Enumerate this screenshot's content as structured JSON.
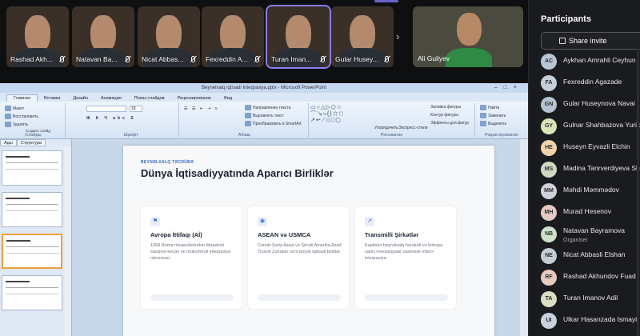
{
  "video_tiles": [
    {
      "name": "Rashad Akh..."
    },
    {
      "name": "Natavan Ba..."
    },
    {
      "name": "Nicat Abbas..."
    },
    {
      "name": "Fexreddin A..."
    },
    {
      "name": "Turan Iman..."
    },
    {
      "name": "Gular Husey..."
    }
  ],
  "featured_tile": {
    "name": "Ali Guliyev"
  },
  "next_icon": "›",
  "ppt": {
    "window_title": "Beynelxalq iqtisadi Inteqrasiya.pptx - Microsoft PowerPoint",
    "tabs": [
      "Главная",
      "Вставка",
      "Дизайн",
      "Анимация",
      "Показ слайдов",
      "Рецензирование",
      "Вид"
    ],
    "ribbon": {
      "paste_label": "Создать слайд",
      "layout_label": "Макет",
      "reset_label": "Восстановить",
      "delete_label": "Удалить",
      "group_slides": "Слайды",
      "group_font": "Шрифт",
      "group_paragraph": "Абзац",
      "group_drawing": "Рисование",
      "group_editing": "Редактирование",
      "text_dir": "Направление текста",
      "align_text": "Выровнять текст",
      "smartart": "Преобразовать в SmartArt",
      "arrange": "Упорядочить",
      "quick_styles": "Экспресс-стили",
      "shape_fill": "Заливка фигуры",
      "shape_outline": "Контур фигуры",
      "shape_effects": "Эффекты для фигур",
      "find": "Найти",
      "replace": "Заменить",
      "select": "Выделить",
      "font_size": "18"
    },
    "left_tabs": [
      "Ады",
      "Структура"
    ],
    "slide": {
      "eyebrow": "BEYNƏLXALQ TƏCRÜBƏ",
      "title": "Dünya İqtisadiyyatında Aparıcı Birliklər",
      "cards": [
        {
          "icon": "⚑",
          "heading": "Avropa İttifaqı (Aİ)",
          "body": "1958 Roma müqaviləsindən Maastrixt sazişinə keçən ən mükəmməl inteqrasiya nümunəsi."
        },
        {
          "icon": "◉",
          "heading": "ASEAN və USMCA",
          "body": "Cənub-Şərqi Asiya və Şimali Amerika Azad Ticarət Zonaları üzrə böyük iqtisadi bloklar."
        },
        {
          "icon": "↗",
          "heading": "Transmilli Şirkətlər",
          "body": "Kapitalın beynəlxalq hərəkəti və birbaşa xarici investisiyalar vasitəsilə mikro-inteqrasiya."
        }
      ]
    }
  },
  "participants": {
    "title": "Participants",
    "invite_label": "Share invite",
    "people": [
      {
        "initials": "AC",
        "name": "Aykhan Amrahli Ceyhun",
        "color": "#b7c6d6",
        "sub": ""
      },
      {
        "initials": "FA",
        "name": "Fexreddin Agazade",
        "color": "#c5cfd9",
        "sub": ""
      },
      {
        "initials": "GN",
        "name": "Gular Huseynova Navai",
        "color": "#b3c3d1",
        "sub": ""
      },
      {
        "initials": "GY",
        "name": "Gulnar Shahbazova Yurik",
        "color": "#d8e6b8",
        "sub": ""
      },
      {
        "initials": "HE",
        "name": "Huseyn Eyvazli Elchin",
        "color": "#f1d4a8",
        "sub": ""
      },
      {
        "initials": "MS",
        "name": "Madina Tanrverdiyeva Sh",
        "color": "#cfd8c0",
        "sub": ""
      },
      {
        "initials": "MM",
        "name": "Məhdi Məmmədov",
        "color": "#cfd0dc",
        "sub": ""
      },
      {
        "initials": "MH",
        "name": "Murad Hesenov",
        "color": "#e6c9c4",
        "sub": ""
      },
      {
        "initials": "NB",
        "name": "Natavan Bayramova",
        "color": "#cfe1c9",
        "sub": "Organiser"
      },
      {
        "initials": "NE",
        "name": "Nicat Abbasli Elshan",
        "color": "#c4ccd6",
        "sub": ""
      },
      {
        "initials": "RF",
        "name": "Rashad Akhundov Fuad",
        "color": "#e8c9c2",
        "sub": ""
      },
      {
        "initials": "TA",
        "name": "Turan Imanov Adil",
        "color": "#d9dfc2",
        "sub": ""
      },
      {
        "initials": "UI",
        "name": "Ulkar Hasanzada Ismayil",
        "color": "#c9d1e1",
        "sub": ""
      }
    ]
  }
}
